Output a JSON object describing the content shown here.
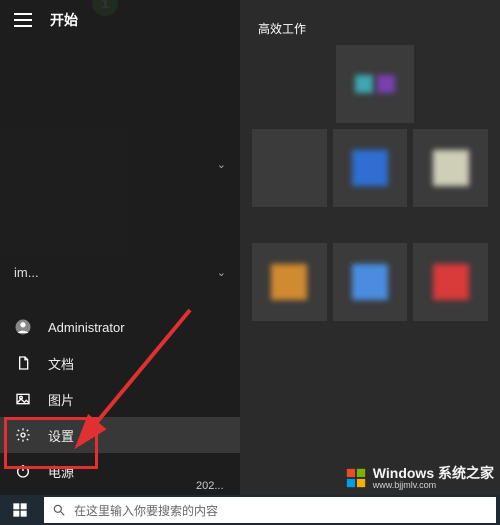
{
  "start": {
    "title": "开始",
    "app_list": [
      {
        "label": "",
        "has_chevron": true
      },
      {
        "label": "im...",
        "has_chevron": true
      }
    ],
    "bottom_menu": [
      {
        "id": "user",
        "label": "Administrator",
        "icon": "user-icon"
      },
      {
        "id": "docs",
        "label": "文档",
        "icon": "document-icon"
      },
      {
        "id": "pictures",
        "label": "图片",
        "icon": "pictures-icon"
      },
      {
        "id": "settings",
        "label": "设置",
        "icon": "gear-icon",
        "highlighted": true
      },
      {
        "id": "power",
        "label": "电源",
        "icon": "power-icon"
      }
    ],
    "footer_text": "202..."
  },
  "tiles": {
    "section_title": "高效工作"
  },
  "taskbar": {
    "search_placeholder": "在这里输入你要搜索的内容"
  },
  "watermark": {
    "title": "Windows 系统之家",
    "url": "www.bjjmlv.com"
  },
  "badge": {
    "number": "1"
  }
}
